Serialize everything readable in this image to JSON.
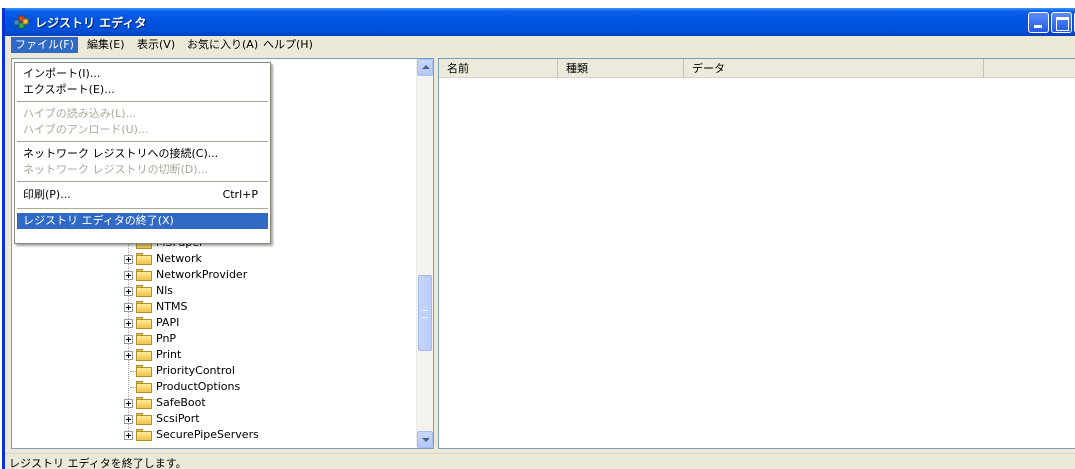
{
  "window": {
    "title": "レジストリ エディタ"
  },
  "menubar": {
    "items": [
      "ファイル(F)",
      "編集(E)",
      "表示(V)",
      "お気に入り(A)",
      "ヘルプ(H)"
    ]
  },
  "file_menu": {
    "import": "インポート(I)...",
    "export": "エクスポート(E)...",
    "load_hive": "ハイブの読み込み(L)...",
    "unload_hive": "ハイブのアンロード(U)...",
    "connect_network": "ネットワーク レジストリへの接続(C)...",
    "disconnect_network": "ネットワーク レジストリの切断(D)...",
    "print": "印刷(P)...",
    "print_shortcut": "Ctrl+P",
    "exit": "レジストリ エディタの終了(X)"
  },
  "tree": {
    "items": [
      "MSPaper",
      "Network",
      "NetworkProvider",
      "Nls",
      "NTMS",
      "PAPI",
      "PnP",
      "Print",
      "PriorityControl",
      "ProductOptions",
      "SafeBoot",
      "ScsiPort",
      "SecurePipeServers"
    ]
  },
  "list": {
    "columns": [
      "名前",
      "種類",
      "データ"
    ]
  },
  "status": {
    "text": "レジストリ エディタを終了します。"
  }
}
